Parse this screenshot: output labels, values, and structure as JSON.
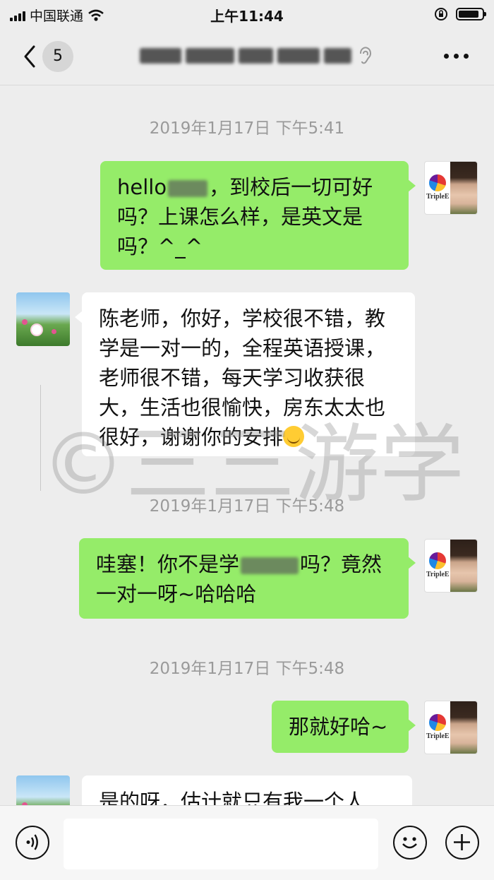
{
  "status_bar": {
    "carrier": "中国联通",
    "time": "上午11:44"
  },
  "nav": {
    "unread_count": "5",
    "title_blurred": true
  },
  "messages": [
    {
      "type": "timestamp",
      "text": "2019年1月17日 下午5:41"
    },
    {
      "type": "sent",
      "parts": [
        "hello",
        "，到校后一切可好吗？上课怎么样，是英文是吗？^_^"
      ]
    },
    {
      "type": "received",
      "text": "陈老师，你好，学校很不错，教学是一对一的，全程英语授课，老师很不错，每天学习收获很大，生活也很愉快，房东太太也很好，谢谢你的安排"
    },
    {
      "type": "timestamp",
      "text": "2019年1月17日 下午5:48"
    },
    {
      "type": "sent",
      "parts": [
        "哇塞！你不是学",
        "吗？竟然一对一呀~哈哈哈"
      ]
    },
    {
      "type": "timestamp",
      "text": "2019年1月17日 下午5:48"
    },
    {
      "type": "sent",
      "text": "那就好哈~"
    },
    {
      "type": "received",
      "text": "是的呀，估计就只有我一个人"
    }
  ],
  "avatar_right_brand": "TripleE",
  "watermark": "©三三游学",
  "icons": [
    "back-chevron-icon",
    "ear-icon",
    "more-icon",
    "voice-icon",
    "emoji-icon",
    "plus-icon"
  ]
}
